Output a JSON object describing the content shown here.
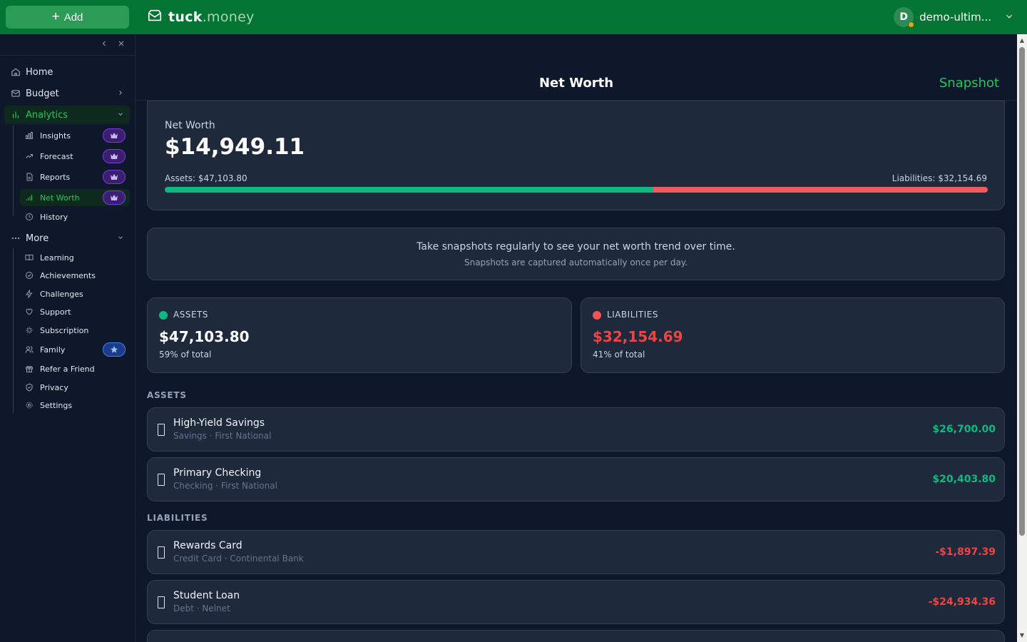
{
  "topbar": {
    "add_label": "Add",
    "brand_bold": "tuck",
    "brand_rest": ".money",
    "user_initial": "D",
    "user_name": "demo-ultim..."
  },
  "sidebar": {
    "items": [
      {
        "label": "Home",
        "icon": "home-icon"
      },
      {
        "label": "Budget",
        "icon": "envelope-icon"
      },
      {
        "label": "Analytics",
        "icon": "bar-chart-icon"
      },
      {
        "label": "More",
        "icon": "more-icon"
      }
    ],
    "analytics_sub": [
      {
        "label": "Insights",
        "icon": "insights-icon"
      },
      {
        "label": "Forecast",
        "icon": "trend-icon"
      },
      {
        "label": "Reports",
        "icon": "report-icon"
      },
      {
        "label": "Net Worth",
        "icon": "signal-icon"
      },
      {
        "label": "History",
        "icon": "clock-icon"
      }
    ],
    "more_sub": [
      {
        "label": "Learning",
        "icon": "book-icon"
      },
      {
        "label": "Achievements",
        "icon": "check-circle-icon"
      },
      {
        "label": "Challenges",
        "icon": "bolt-icon"
      },
      {
        "label": "Support",
        "icon": "heart-icon"
      },
      {
        "label": "Subscription",
        "icon": "sparkle-icon"
      },
      {
        "label": "Family",
        "icon": "users-icon"
      },
      {
        "label": "Refer a Friend",
        "icon": "gift-icon"
      },
      {
        "label": "Privacy",
        "icon": "shield-icon"
      },
      {
        "label": "Settings",
        "icon": "gear-icon"
      }
    ]
  },
  "page": {
    "title": "Net Worth",
    "snapshot_label": "Snapshot"
  },
  "networth": {
    "label": "Net Worth",
    "value": "$14,949.11",
    "assets_label": "Assets: $47,103.80",
    "liabilities_label": "Liabilities: $32,154.69",
    "assets_share": 0.594
  },
  "tip": {
    "main": "Take snapshots regularly to see your net worth trend over time.",
    "sub": "Snapshots are captured automatically once per day."
  },
  "summary": {
    "assets": {
      "title": "ASSETS",
      "value": "$47,103.80",
      "pct": "59% of total"
    },
    "liabilities": {
      "title": "LIABILITIES",
      "value": "$32,154.69",
      "pct": "41% of total"
    }
  },
  "sections": {
    "assets_heading": "ASSETS",
    "liabilities_heading": "LIABILITIES"
  },
  "assets": [
    {
      "name": "High-Yield Savings",
      "sub": "Savings · First National",
      "value": "$26,700.00"
    },
    {
      "name": "Primary Checking",
      "sub": "Checking · First National",
      "value": "$20,403.80"
    }
  ],
  "liabilities": [
    {
      "name": "Rewards Card",
      "sub": "Credit Card · Continental Bank",
      "value": "-$1,897.39"
    },
    {
      "name": "Student Loan",
      "sub": "Debt · Nelnet",
      "value": "-$24,934.36"
    }
  ],
  "colors": {
    "brand_green": "#047432",
    "asset_green": "#10b981",
    "liability_red": "#ef4444",
    "accent_green": "#22c55e"
  }
}
